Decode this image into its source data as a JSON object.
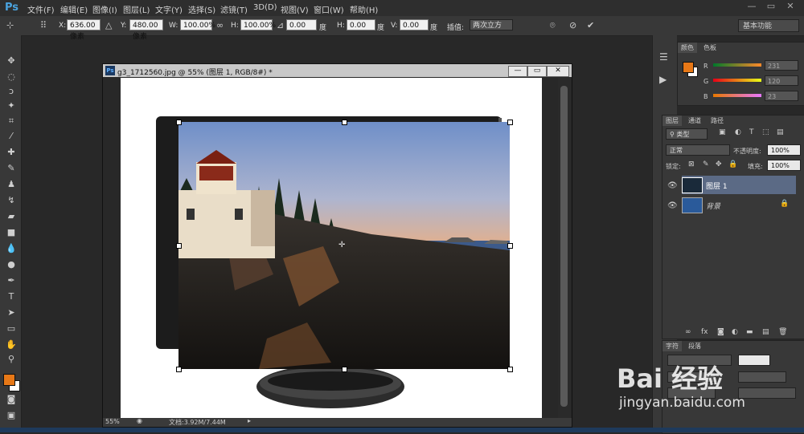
{
  "app": {
    "logo": "Ps"
  },
  "menu": [
    "文件(F)",
    "编辑(E)",
    "图像(I)",
    "图层(L)",
    "文字(Y)",
    "选择(S)",
    "滤镜(T)",
    "3D(D)",
    "视图(V)",
    "窗口(W)",
    "帮助(H)"
  ],
  "window_controls": {
    "minimize": "—",
    "restore": "▭",
    "close": "✕"
  },
  "options": {
    "x_label": "X:",
    "x_value": "636.00 像素",
    "y_label": "Y:",
    "y_value": "480.00 像素",
    "w_label": "W:",
    "w_value": "100.00%",
    "h_label": "H:",
    "h_value": "100.00%",
    "angle_value": "0.00",
    "angle_unit": "度",
    "hskew_label": "H:",
    "hskew_value": "0.00",
    "hskew_unit": "度",
    "vskew_label": "V:",
    "vskew_value": "0.00",
    "vskew_unit": "度",
    "interp_label": "插值:",
    "interp_value": "两次立方",
    "preset": "基本功能"
  },
  "document": {
    "title": "g3_1712560.jpg @ 55% (图层 1, RGB/8#) *",
    "icon": "Ps",
    "zoom": "55%",
    "doc_size": "文档:3.92M/7.44M"
  },
  "color_panel": {
    "tabs": [
      "颜色",
      "色板"
    ],
    "r_label": "R",
    "g_label": "G",
    "b_label": "B",
    "r_value": "231",
    "g_value": "120",
    "b_value": "23",
    "fg_color": "#e77817"
  },
  "layers_panel": {
    "tabs": [
      "图层",
      "通道",
      "路径"
    ],
    "kind_filter": "类型",
    "blend_mode": "正常",
    "opacity_label": "不透明度:",
    "opacity_value": "100%",
    "lock_label": "锁定:",
    "fill_label": "填充:",
    "fill_value": "100%",
    "layers": [
      {
        "name": "图层 1"
      },
      {
        "name": "背景"
      }
    ]
  },
  "char_panel": {
    "tabs": [
      "字符",
      "段落"
    ]
  },
  "watermark": {
    "brand": "Bai 经验",
    "url": "jingyan.baidu.com"
  }
}
